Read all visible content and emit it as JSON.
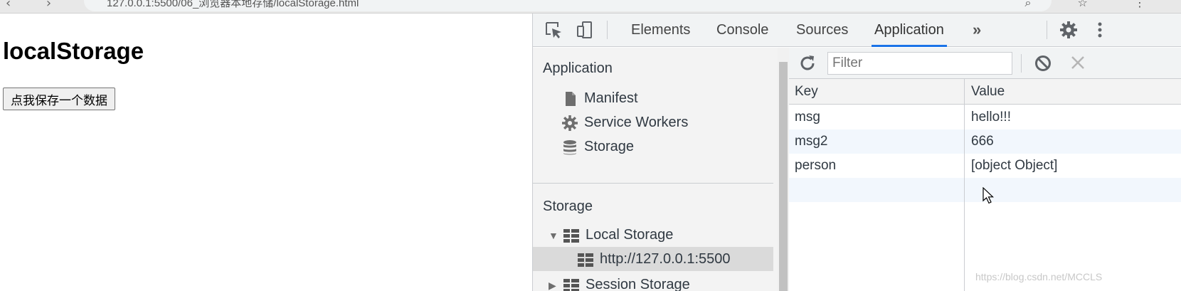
{
  "browser": {
    "url": "127.0.0.1:5500/06_浏览器本地存储/localStorage.html"
  },
  "page": {
    "heading": "localStorage",
    "save_button": "点我保存一个数据"
  },
  "devtools": {
    "tabs": [
      {
        "label": "Elements"
      },
      {
        "label": "Console"
      },
      {
        "label": "Sources"
      },
      {
        "label": "Application"
      }
    ],
    "more_tabs": "»",
    "sidebar": {
      "application_header": "Application",
      "application_items": [
        {
          "label": "Manifest",
          "icon": "file-icon"
        },
        {
          "label": "Service Workers",
          "icon": "gear-icon"
        },
        {
          "label": "Storage",
          "icon": "database-icon"
        }
      ],
      "storage_header": "Storage",
      "local_storage": "Local Storage",
      "local_storage_origin": "http://127.0.0.1:5500",
      "session_storage": "Session Storage"
    },
    "storage_panel": {
      "filter_placeholder": "Filter",
      "columns": {
        "key": "Key",
        "value": "Value"
      },
      "rows": [
        {
          "key": "msg",
          "value": "hello!!!"
        },
        {
          "key": "msg2",
          "value": "666"
        },
        {
          "key": "person",
          "value": "[object Object]"
        }
      ]
    }
  },
  "watermark": "https://blog.csdn.net/MCCLS",
  "colors": {
    "accent": "#1a73e8",
    "devtools_bg": "#f1f3f4",
    "sidebar_bg": "#f3f3f3",
    "selected_row": "#dadada",
    "alt_row": "#f2f7fd"
  }
}
